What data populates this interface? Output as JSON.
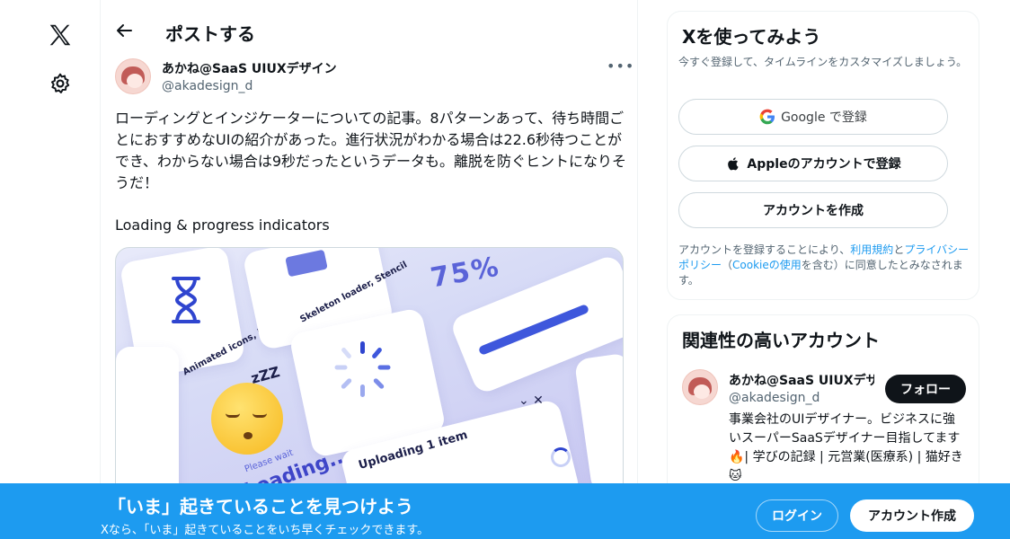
{
  "nav": {
    "logo_icon": "x-logo-icon",
    "settings_icon": "gear-icon"
  },
  "header": {
    "back_icon": "arrow-left-icon",
    "title": "ポストする"
  },
  "post": {
    "author_name": "あかね@SaaS UIUXデザイン",
    "author_handle": "@akadesign_d",
    "more_label": "•••",
    "text": "ローディングとインジケーターについての記事。8パターンあって、待ち時間ごとにおすすめなUIの紹介があった。進行状況がわかる場合は22.6秒待つことができ、わからない場合は9秒だったというデータも。離脱を防ぐヒントになりそうだ！",
    "subtext": "Loading & progress indicators",
    "media": {
      "card1_label": "Animated icons, illustrations",
      "card2_label": "Skeleton loader, Stencil",
      "percent_text": "75%",
      "please_wait": "Please wait",
      "loading_text": "Loading...",
      "uploading_text": "Uploading 1 item",
      "zzz": "zZZ"
    }
  },
  "signup_panel": {
    "title": "Xを使ってみよう",
    "subtitle": "今すぐ登録して、タイムラインをカスタマイズしましょう。",
    "google_label": "Google で登録",
    "apple_label": "Appleのアカウントで登録",
    "create_label": "アカウントを作成",
    "legal_prefix": "アカウントを登録することにより、",
    "legal_terms": "利用規約",
    "legal_and": "と",
    "legal_privacy": "プライバシーポリシー",
    "legal_paren_open": "（",
    "legal_cookie": "Cookieの使用",
    "legal_suffix": "を含む）に同意したとみなされます。"
  },
  "related_panel": {
    "title": "関連性の高いアカウント",
    "account_name": "あかね@SaaS UIUXデザ",
    "account_handle": "@akadesign_d",
    "follow_label": "フォロー",
    "bio": "事業会社のUIデザイナー。ビジネスに強いスーパーSaaSデザイナー目指してます🔥| 学びの記録 | 元営業(医療系) | 猫好き🐱"
  },
  "banner": {
    "title": "「いま」起きていることを見つけよう",
    "subtitle": "Xなら、「いま」起きていることをいち早くチェックできます。",
    "login_label": "ログイン",
    "signup_label": "アカウント作成"
  },
  "colors": {
    "accent": "#1d9bf0",
    "text": "#0f1419",
    "muted": "#536471"
  }
}
